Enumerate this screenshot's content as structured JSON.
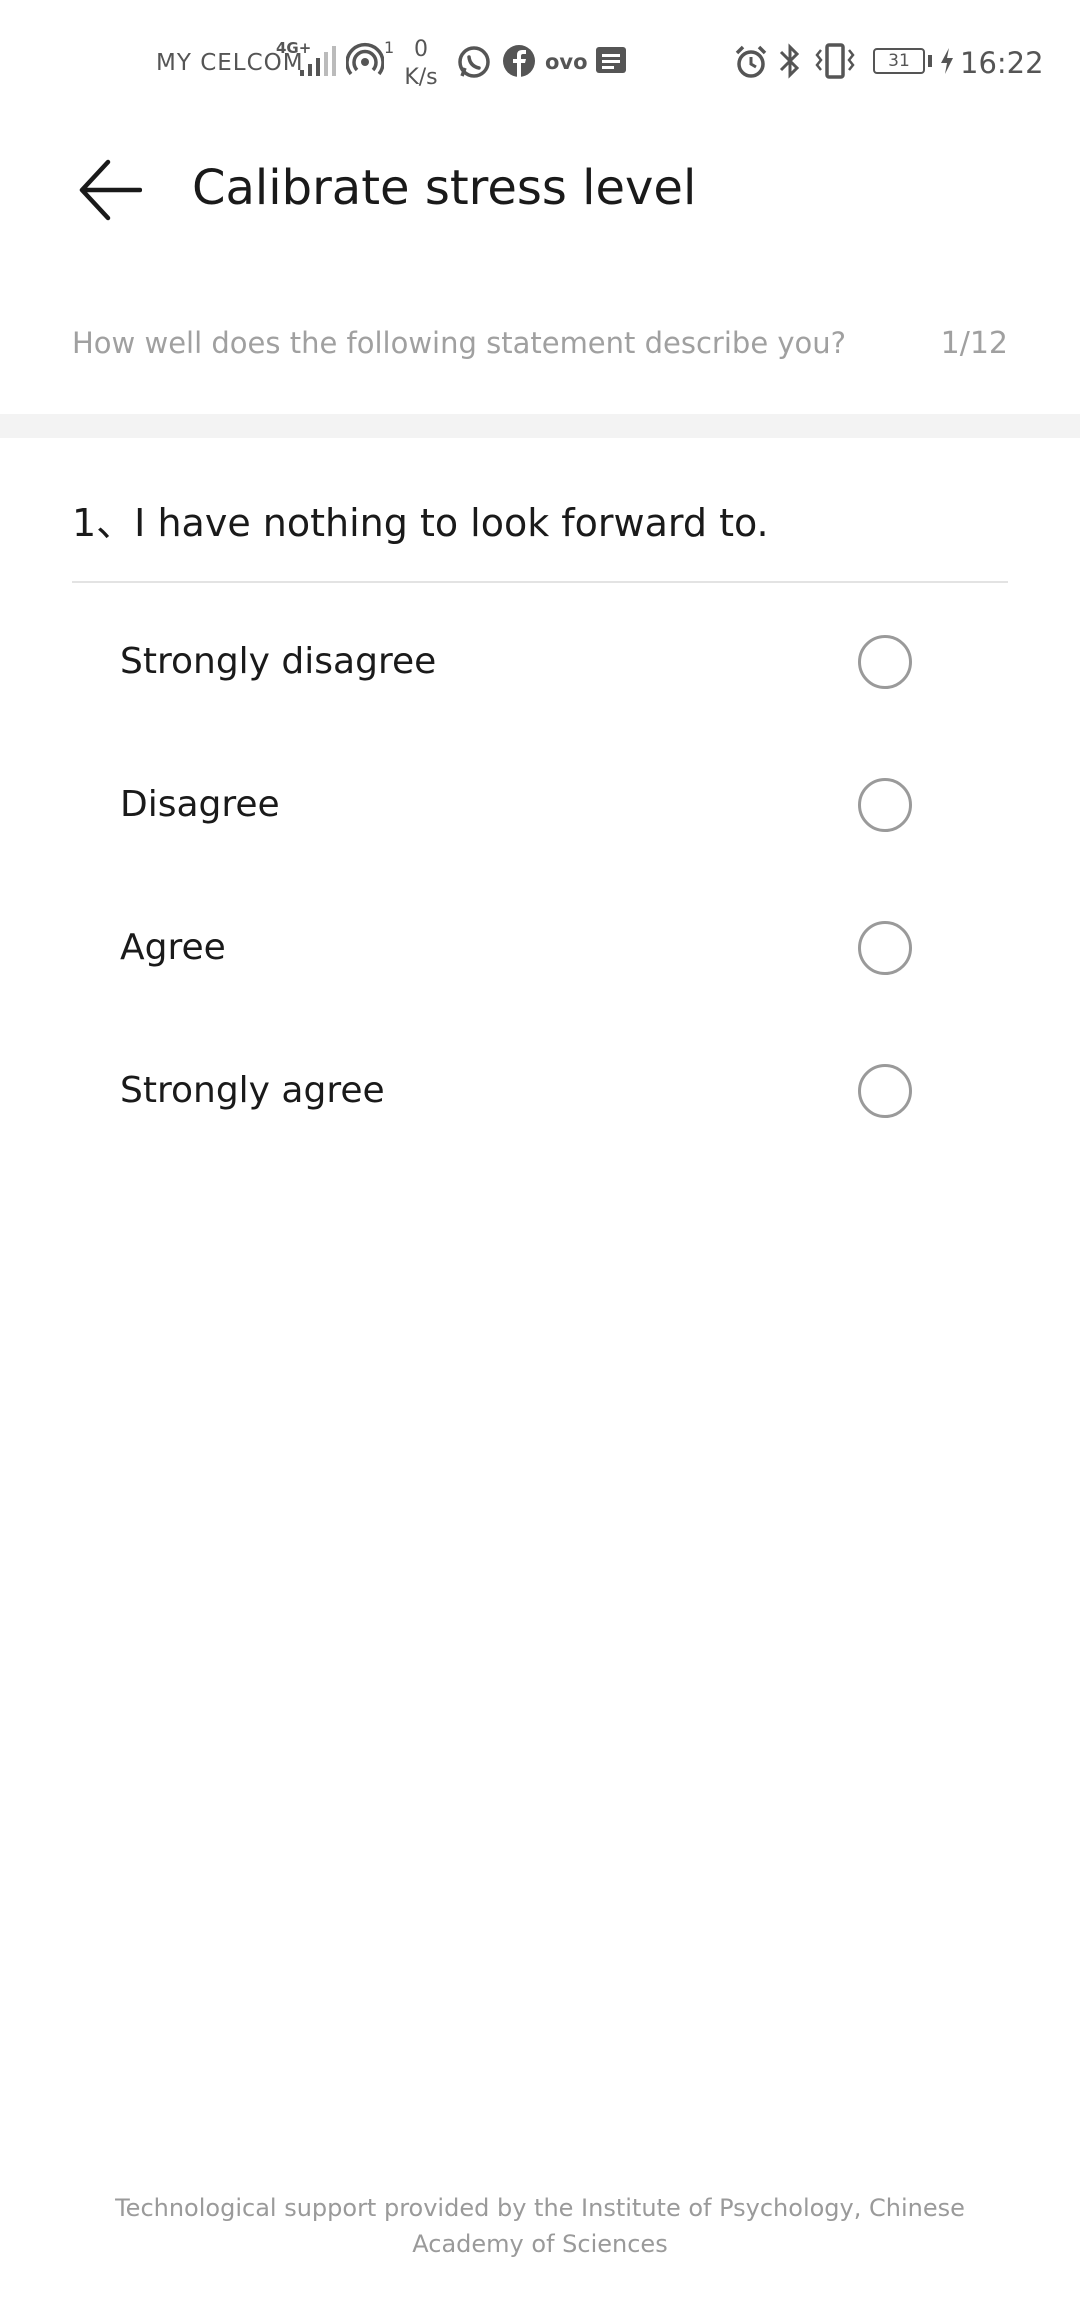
{
  "status_bar": {
    "carrier": "MY CELCOM",
    "network_type": "4G+",
    "hotspot_count": "1",
    "speed_value": "0",
    "speed_unit": "K/s",
    "ovo_label": "ovo",
    "battery": "31",
    "time": "16:22",
    "icon_color": "#555555"
  },
  "header": {
    "title": "Calibrate stress level"
  },
  "survey": {
    "prompt": "How well does the following statement describe you?",
    "progress": "1/12",
    "question": "1、I have nothing to look forward to.",
    "options": [
      {
        "label": "Strongly disagree",
        "selected": false
      },
      {
        "label": "Disagree",
        "selected": false
      },
      {
        "label": "Agree",
        "selected": false
      },
      {
        "label": "Strongly agree",
        "selected": false
      }
    ]
  },
  "footer": {
    "text": "Technological support provided by the Institute of Psychology, Chinese Academy of Sciences"
  },
  "colors": {
    "text_primary": "#1a1a1a",
    "text_secondary": "#a0a0a0",
    "band": "#f3f3f3",
    "radio_border": "#9a9a9a"
  }
}
